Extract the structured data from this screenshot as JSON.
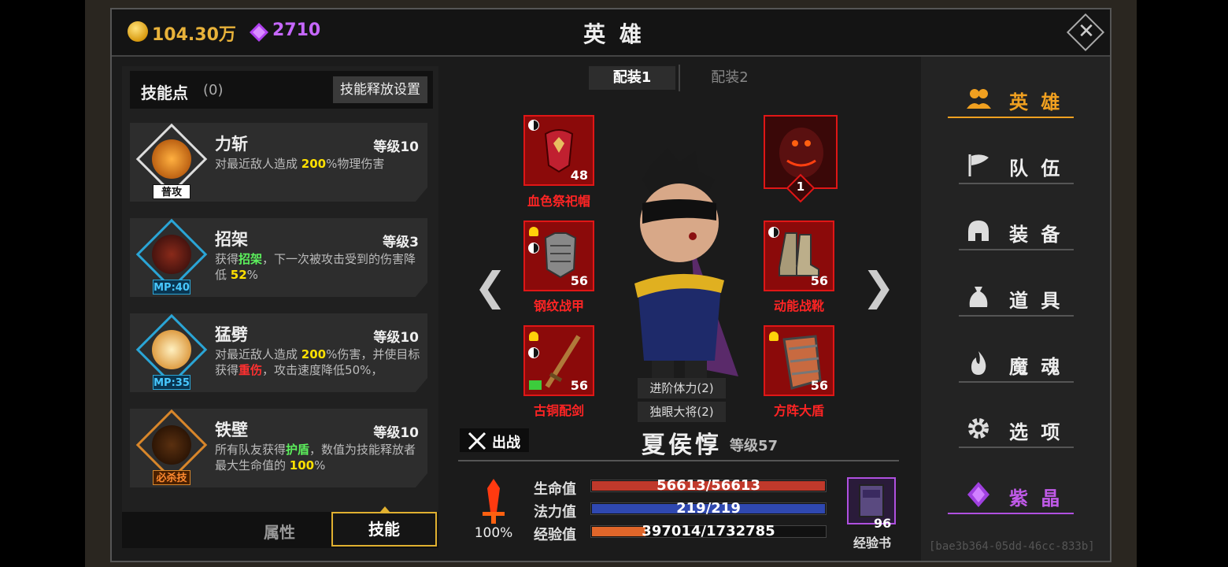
{
  "header": {
    "gold": "104.30万",
    "gems": "2710",
    "title": "英 雄",
    "close_symbol": "✕"
  },
  "skills_panel": {
    "points_label": "技能点",
    "points_count": "(0)",
    "release_settings_label": "技能释放设置",
    "skills": [
      {
        "name": "力斩",
        "level": "等级10",
        "tag": "普攻",
        "icon": "sword-slash-icon",
        "desc": [
          {
            "t": "对最近敌人造成 "
          },
          {
            "t": "200",
            "c": "y"
          },
          {
            "t": "%物理伤害"
          }
        ]
      },
      {
        "name": "招架",
        "level": "等级3",
        "tag": "MP:40",
        "icon": "shield-parry-icon",
        "desc": [
          {
            "t": "获得"
          },
          {
            "t": "招架",
            "c": "g"
          },
          {
            "t": "，下一次被攻击受到的伤害降低 "
          },
          {
            "t": "52",
            "c": "y"
          },
          {
            "t": "%"
          }
        ]
      },
      {
        "name": "猛劈",
        "level": "等级10",
        "tag": "MP:35",
        "icon": "cleave-icon",
        "desc": [
          {
            "t": "对最近敌人造成 "
          },
          {
            "t": "200",
            "c": "y"
          },
          {
            "t": "%伤害，并使目标获得"
          },
          {
            "t": "重伤",
            "c": "r"
          },
          {
            "t": "，攻击速度降低50%，"
          }
        ]
      },
      {
        "name": "铁壁",
        "level": "等级10",
        "tag": "必杀技",
        "icon": "iron-wall-icon",
        "desc": [
          {
            "t": "所有队友获得"
          },
          {
            "t": "护盾",
            "c": "g"
          },
          {
            "t": "，数值为技能释放者最大生命值的 "
          },
          {
            "t": "100",
            "c": "y"
          },
          {
            "t": "%"
          }
        ]
      }
    ],
    "bottom_tabs": {
      "attr": "属性",
      "skill": "技能"
    }
  },
  "loadout_tabs": {
    "tab1": "配装1",
    "tab2": "配装2"
  },
  "equipment": {
    "helmet": {
      "name": "血色祭祀帽",
      "level": "48",
      "icon": "helmet-icon"
    },
    "pet": {
      "level": "1",
      "icon": "demon-pet-icon"
    },
    "armor": {
      "name": "钢纹战甲",
      "level": "56",
      "icon": "armor-icon"
    },
    "boots": {
      "name": "动能战靴",
      "level": "56",
      "icon": "boots-icon"
    },
    "sword": {
      "name": "古铜配剑",
      "level": "56",
      "icon": "sword-icon"
    },
    "shield": {
      "name": "方阵大盾",
      "level": "56",
      "icon": "shield-icon"
    }
  },
  "nav_arrows": {
    "left": "❮",
    "right": "❯"
  },
  "hero": {
    "buff1": "进阶体力(2)",
    "buff2": "独眼大将(2)",
    "fight_label": "出战",
    "name": "夏侯惇",
    "level": "等级57"
  },
  "stats": {
    "power_pct": "100%",
    "hp_label": "生命值",
    "hp_text": "56613/56613",
    "hp_ratio": 1.0,
    "mp_label": "法力值",
    "mp_text": "219/219",
    "mp_ratio": 1.0,
    "exp_label": "经验值",
    "exp_text": "397014/1732785",
    "exp_ratio": 0.23,
    "book_count": "96",
    "book_label": "经验书"
  },
  "menu": [
    {
      "label": "英 雄",
      "icon": "heroes-icon"
    },
    {
      "label": "队 伍",
      "icon": "flag-icon"
    },
    {
      "label": "装 备",
      "icon": "helmet-icon"
    },
    {
      "label": "道 具",
      "icon": "bag-icon"
    },
    {
      "label": "魔 魂",
      "icon": "flame-icon"
    },
    {
      "label": "选 项",
      "icon": "gear-icon"
    },
    {
      "label": "紫 晶",
      "icon": "amethyst-icon"
    }
  ],
  "id_text": "[bae3b364-05dd-46cc-833b]",
  "colors": {
    "hp": "#c0392b",
    "mp": "#2f48b0",
    "exp": "#e0662a",
    "accent": "#f0a020",
    "purple": "#c05ae8"
  }
}
